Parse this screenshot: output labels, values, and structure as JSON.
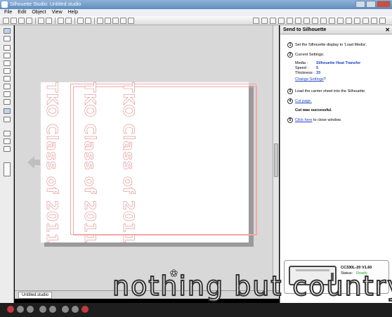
{
  "window": {
    "title": "Silhouette Studio: Untitled.studio"
  },
  "menu": [
    "File",
    "Edit",
    "Object",
    "View",
    "Help"
  ],
  "document_tab": "Untitled.studio",
  "design_lines": [
    "TKO Class of 2011",
    "TKO Class of 2011",
    "TKO Class of 2011"
  ],
  "panel": {
    "title": "Send to Silhouette",
    "close_icon": "close-icon",
    "step1": "Set the Silhouette display to 'Load Media'.",
    "step2_heading": "Current Settings:",
    "media_label": "Media :",
    "media_value": "Silhouette Heat Transfer",
    "speed_label": "Speed :",
    "speed_value": "5",
    "thickness_label": "Thickness :",
    "thickness_value": "33",
    "change_settings_link": "Change Settings",
    "change_settings_suffix": "?",
    "step3": "Load the carrier sheet into the Silhouette.",
    "cut_page_link": "Cut page.",
    "cut_success": "Cut was successful.",
    "click_here_link": "Click here",
    "close_window_text": "to close window.",
    "device_name": "CC330L-20 V1.60",
    "status_label": "Status:",
    "status_value": "Ready",
    "status_color": "#22aa22"
  },
  "watermark": "nothing but country"
}
